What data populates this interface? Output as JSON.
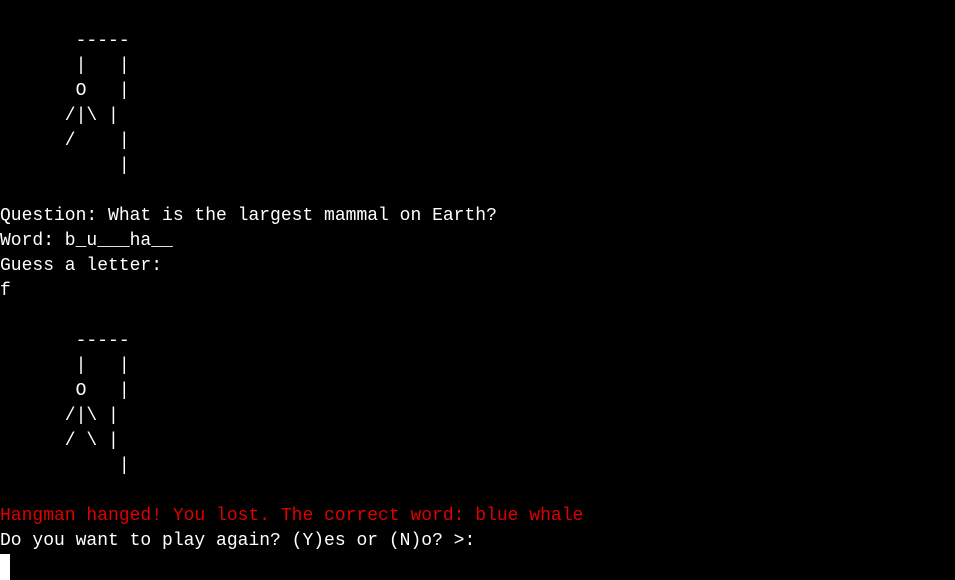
{
  "terminal": {
    "drawing_1": [
      "       -----",
      "       |   |",
      "       O   |",
      "      /|\\ |",
      "      /    |",
      "           |"
    ],
    "question": "Question: What is the largest mammal on Earth?",
    "word": "Word: b_u___ha__",
    "prompt": "Guess a letter:",
    "input": "f",
    "drawing_2": [
      "       -----",
      "       |   |",
      "       O   |",
      "      /|\\ |",
      "      / \\ |",
      "           |"
    ],
    "result": "Hangman hanged! You lost. The correct word: blue whale",
    "replay_prompt": "Do you want to play again? (Y)es or (N)o? >:"
  },
  "colors": {
    "background": "#000000",
    "text": "#ffffff",
    "error": "#e00000"
  }
}
